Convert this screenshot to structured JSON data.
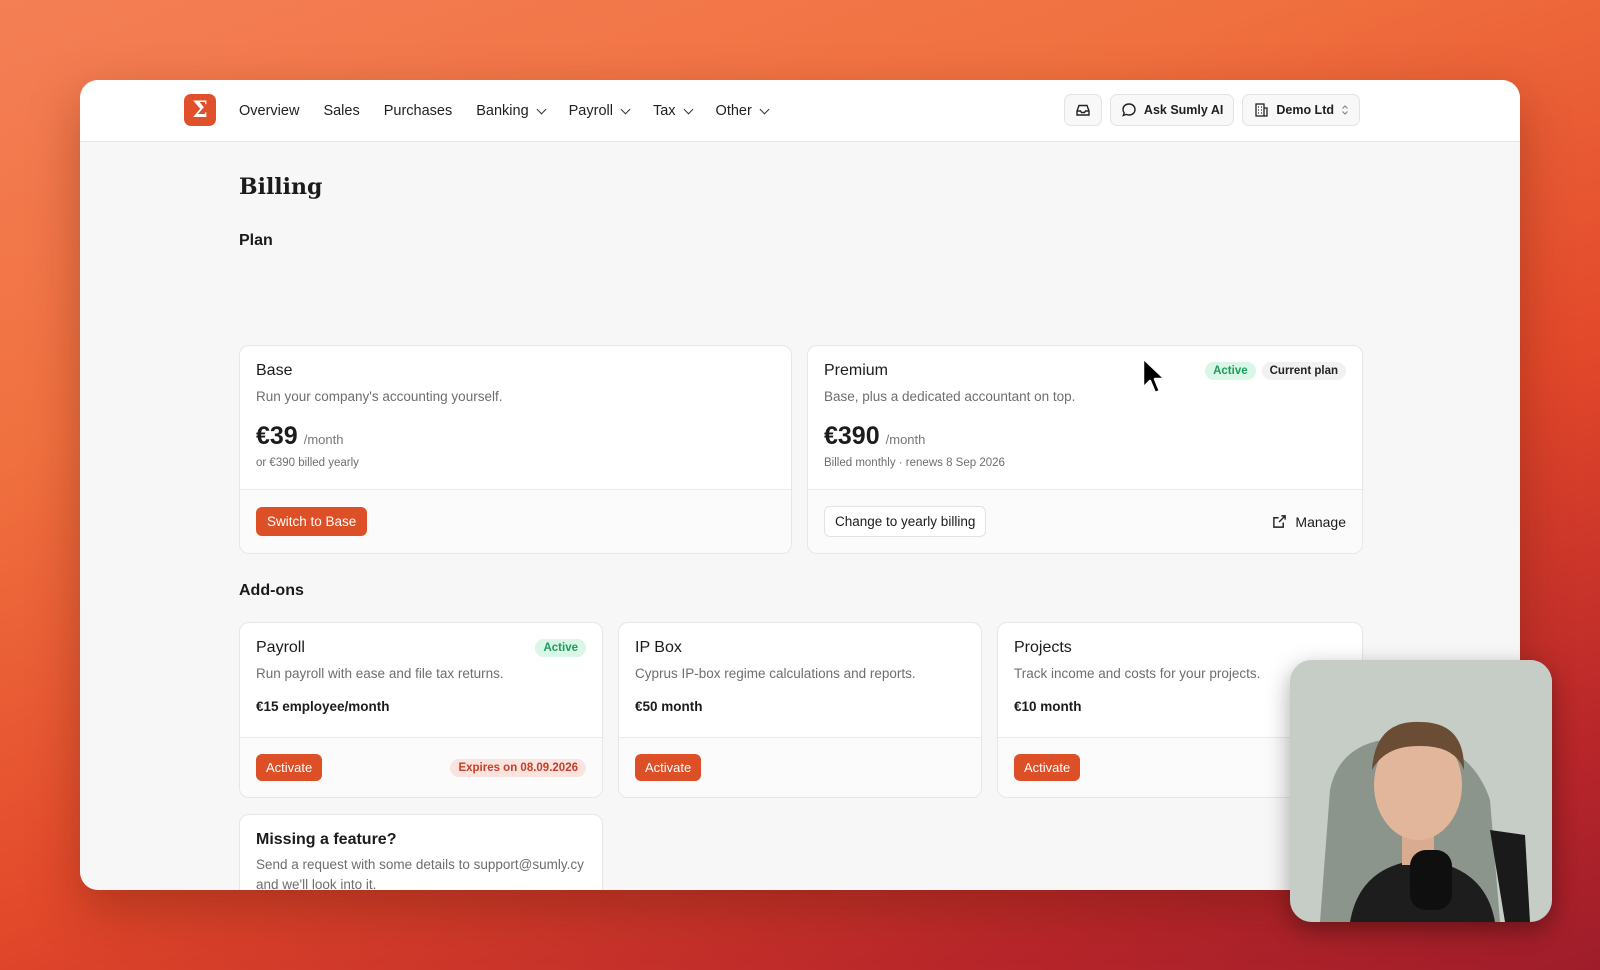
{
  "brand": {
    "logo_glyph": "Σ",
    "accent": "#dd4f26"
  },
  "nav": {
    "items": [
      {
        "label": "Overview",
        "dropdown": false
      },
      {
        "label": "Sales",
        "dropdown": false
      },
      {
        "label": "Purchases",
        "dropdown": false
      },
      {
        "label": "Banking",
        "dropdown": true
      },
      {
        "label": "Payroll",
        "dropdown": true
      },
      {
        "label": "Tax",
        "dropdown": true
      },
      {
        "label": "Other",
        "dropdown": true
      }
    ]
  },
  "topbar": {
    "inbox_icon": "inbox-icon",
    "ask_ai_label": "Ask Sumly AI",
    "company_label": "Demo Ltd"
  },
  "page": {
    "title": "Billing"
  },
  "plan": {
    "section_title": "Plan",
    "base": {
      "name": "Base",
      "description": "Run your company's accounting yourself.",
      "price": "€39",
      "period": "/month",
      "subtext": "or €390 billed yearly",
      "action_label": "Switch to Base"
    },
    "premium": {
      "name": "Premium",
      "description": "Base, plus a dedicated accountant on top.",
      "price": "€390",
      "period": "/month",
      "subtext": "Billed monthly · renews 8 Sep 2026",
      "badge_active": "Active",
      "badge_current": "Current plan",
      "action_label": "Change to yearly billing",
      "manage_label": "Manage"
    }
  },
  "addons": {
    "section_title": "Add-ons",
    "payroll": {
      "name": "Payroll",
      "description": "Run payroll with ease and file tax returns.",
      "price": "€15 employee/month",
      "badge_active": "Active",
      "action_label": "Activate",
      "expires_label": "Expires on 08.09.2026"
    },
    "ipbox": {
      "name": "IP Box",
      "description": "Cyprus IP-box regime calculations and reports.",
      "price": "€50 month",
      "action_label": "Activate"
    },
    "projects": {
      "name": "Projects",
      "description": "Track income and costs for your projects.",
      "price": "€10 month",
      "action_label": "Activate"
    }
  },
  "missing_feature": {
    "title": "Missing a feature?",
    "text": "Send a request with some details to support@sumly.cy and we'll look into it."
  }
}
